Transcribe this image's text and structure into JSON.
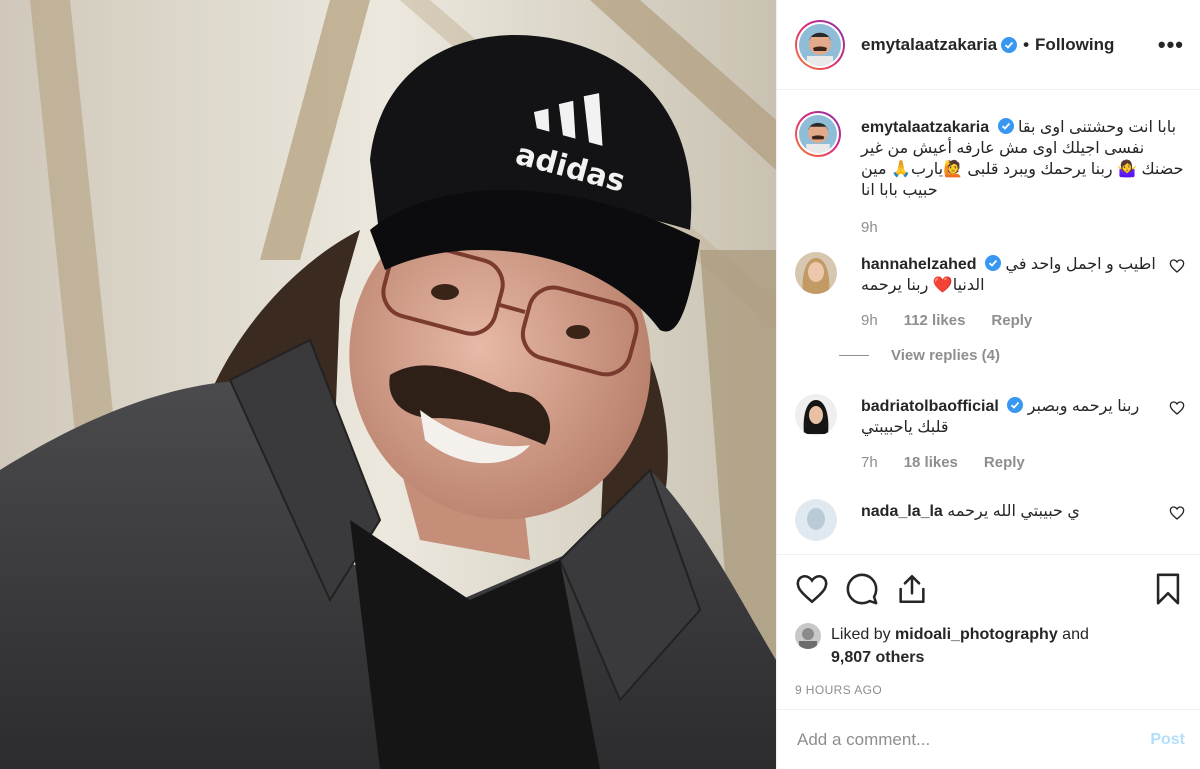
{
  "photo": {
    "logo_text": "adidas"
  },
  "header": {
    "username": "emytalaatzakaria",
    "separator": "•",
    "follow_status": "Following",
    "more_label": "•••"
  },
  "caption": {
    "username": "emytalaatzakaria",
    "text": "بابا انت وحشتنى اوى بقا نفسى اجيلك اوى مش عارفه أعيش من غير حضنك 🤷‍♀️ ربنا يرحمك ويبرد قلبى 🙋يارب🙏 مين حبيب بابا انا",
    "time": "9h"
  },
  "comments": [
    {
      "username": "hannahelzahed",
      "verified": true,
      "text": "اطيب و اجمل واحد في الدنيا❤️ ربنا يرحمه",
      "time": "9h",
      "likes": "112 likes",
      "reply": "Reply",
      "view_replies": "View replies (4)"
    },
    {
      "username": "badriatolbaofficial",
      "verified": true,
      "text": "ربنا يرحمه وبصبر قلبك ياحبيبتي",
      "time": "7h",
      "likes": "18 likes",
      "reply": "Reply"
    },
    {
      "username": "nada_la_la",
      "verified": false,
      "text": "ي حبيبتي الله يرحمه"
    }
  ],
  "likes": {
    "prefix": "Liked by",
    "user": "midoali_photography",
    "and": "and",
    "others": "9,807 others"
  },
  "timestamp": "9 HOURS AGO",
  "add_comment": {
    "placeholder": "Add a comment...",
    "post_label": "Post"
  },
  "colors": {
    "verified": "#3897f0",
    "heart_red": "#ed4956",
    "muted": "#8e8e8e",
    "post_disabled": "#b2dffc"
  },
  "icons": [
    "heart-icon",
    "comment-icon",
    "share-icon",
    "bookmark-icon",
    "verified-badge-icon",
    "more-icon"
  ]
}
